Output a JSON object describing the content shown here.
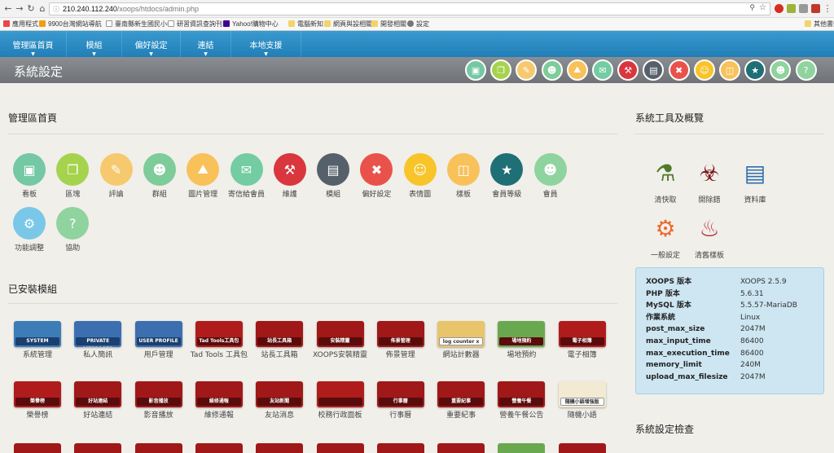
{
  "browser": {
    "url_host": "210.240.112.240",
    "url_path": "/xoops/htdocs/admin.php",
    "bookmarks": [
      "應用程式",
      "9900台灣網站導航",
      "臺南縣新生國民小學",
      "研習資訊查詢刊",
      "Yahoo!購物中心",
      "電腦新知",
      "網頁與設相關",
      "開發相關",
      "設定"
    ],
    "other_bookmarks": "其他書籤"
  },
  "topnav": [
    "管理區首頁",
    "模組",
    "偏好設定",
    "連結",
    "本地支援"
  ],
  "page_title": "系統設定",
  "title_icons": [
    "monitor-icon",
    "cubes-icon",
    "comment-icon",
    "group-icon",
    "image-icon",
    "mail-icon",
    "broom-icon",
    "database-icon",
    "tools-icon",
    "smiley-icon",
    "template-icon",
    "rank-icon",
    "users-icon",
    "help-icon"
  ],
  "admin_home": {
    "heading": "管理區首頁",
    "items": [
      {
        "label": "看板",
        "icon": "monitor-icon",
        "color": "#74c8a3"
      },
      {
        "label": "區塊",
        "icon": "cubes-icon",
        "color": "#a6d34d"
      },
      {
        "label": "評論",
        "icon": "comment-icon",
        "color": "#f6c96f"
      },
      {
        "label": "群組",
        "icon": "group-icon",
        "color": "#7dcc9a"
      },
      {
        "label": "圖片管理",
        "icon": "image-icon",
        "color": "#f8c15a"
      },
      {
        "label": "寄信給會員",
        "icon": "mail-icon",
        "color": "#73cca2"
      },
      {
        "label": "維護",
        "icon": "broom-icon",
        "color": "#d9363e"
      },
      {
        "label": "模組",
        "icon": "database-icon",
        "color": "#56606b"
      },
      {
        "label": "偏好設定",
        "icon": "tools-icon",
        "color": "#e9524a"
      },
      {
        "label": "表情圖",
        "icon": "smiley-icon",
        "color": "#f8c42a"
      },
      {
        "label": "樣板",
        "icon": "template-icon",
        "color": "#f8c15a"
      },
      {
        "label": "會員等級",
        "icon": "rank-icon",
        "color": "#1f6f76"
      },
      {
        "label": "會員",
        "icon": "users-icon",
        "color": "#8fd39f"
      },
      {
        "label": "功能調整",
        "icon": "gear-icon",
        "color": "#7ac7e8"
      },
      {
        "label": "協助",
        "icon": "help-icon",
        "color": "#8fd39f"
      }
    ]
  },
  "modules": {
    "heading": "已安裝模組",
    "items": [
      {
        "label": "系統管理",
        "tag": "SYSTEM",
        "bg": "#3c7db8"
      },
      {
        "label": "私人簡訊",
        "tag": "PRIVATE MESSAGES",
        "bg": "#3c6fb0"
      },
      {
        "label": "用戶管理",
        "tag": "USER PROFILE",
        "bg": "#3c6fb0"
      },
      {
        "label": "Tad Tools 工具包",
        "tag": "Tad Tools工具包",
        "bg": "#b01c1c"
      },
      {
        "label": "站長工具箱",
        "tag": "站長工具箱",
        "bg": "#a01818"
      },
      {
        "label": "XOOPS安裝精靈",
        "tag": "安裝精靈",
        "bg": "#a01818"
      },
      {
        "label": "佈景管理",
        "tag": "佈景管理",
        "bg": "#a01818"
      },
      {
        "label": "網站計數器",
        "tag": "log counter x",
        "bg": "#e8c46a"
      },
      {
        "label": "場地預約",
        "tag": "場地預約",
        "bg": "#6aa84f"
      },
      {
        "label": "電子相簿",
        "tag": "電子相簿",
        "bg": "#b01c1c"
      },
      {
        "label": "榮譽榜",
        "tag": "榮譽榜",
        "bg": "#b01c1c"
      },
      {
        "label": "好站連結",
        "tag": "好站連結",
        "bg": "#a01818"
      },
      {
        "label": "影音播放",
        "tag": "影音播放",
        "bg": "#a01818"
      },
      {
        "label": "維修通報",
        "tag": "維修通報",
        "bg": "#a01818"
      },
      {
        "label": "友站消息",
        "tag": "友站新聞",
        "bg": "#a01818"
      },
      {
        "label": "校務行政面板",
        "tag": "",
        "bg": "#b01c1c"
      },
      {
        "label": "行事曆",
        "tag": "行事曆",
        "bg": "#a01818"
      },
      {
        "label": "重要紀事",
        "tag": "重要紀事",
        "bg": "#a01818"
      },
      {
        "label": "營養午餐公告",
        "tag": "營養午餐",
        "bg": "#a01818"
      },
      {
        "label": "隨機小語",
        "tag": "隨機小語增強版",
        "bg": "#f2ead2"
      }
    ]
  },
  "system_tools": {
    "heading": "系統工具及概覽",
    "items": [
      {
        "label": "清快取",
        "icon": "sweeper-icon"
      },
      {
        "label": "開除錯",
        "icon": "bug-icon"
      },
      {
        "label": "資料庫",
        "icon": "server-icon"
      },
      {
        "label": "一般設定",
        "icon": "gears-icon"
      },
      {
        "label": "清舊樣板",
        "icon": "vacuum-icon"
      }
    ]
  },
  "system_info": [
    {
      "k": "XOOPS 版本",
      "v": "XOOPS 2.5.9"
    },
    {
      "k": "PHP 版本",
      "v": "5.6.31"
    },
    {
      "k": "MySQL 版本",
      "v": "5.5.57-MariaDB"
    },
    {
      "k": "作業系統",
      "v": "Linux"
    },
    {
      "k": "post_max_size",
      "v": "2047M"
    },
    {
      "k": "max_input_time",
      "v": "86400"
    },
    {
      "k": "max_execution_time",
      "v": "86400"
    },
    {
      "k": "memory_limit",
      "v": "240M"
    },
    {
      "k": "upload_max_filesize",
      "v": "2047M"
    }
  ],
  "system_check_heading": "系統設定檢查"
}
